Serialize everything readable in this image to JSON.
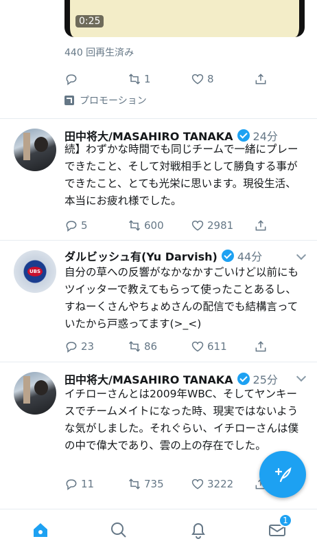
{
  "promo_tweet": {
    "video_duration": "0:25",
    "views": "440 回再生済み",
    "replies": "",
    "retweets": "1",
    "likes": "8",
    "promoted_label": "プロモーション"
  },
  "tweets": [
    {
      "author": "田中将大/MASAHIRO TANAKA",
      "time": "24分",
      "text": "続】わずかな時間でも同じチームで一緒にプレーできたこと、そして対戦相手として勝負する事ができたこと、とても光栄に思います。現役生活、本当にお疲れ様でした。",
      "replies": "5",
      "retweets": "600",
      "likes": "2981"
    },
    {
      "author": "ダルビッシュ有(Yu Darvish)",
      "time": "44分",
      "text": "自分の草への反響がなかなかすごいけど以前にもツイッターで教えてもらって使ったことあるし、すねーくさんやちょめさんの配信でも結構言っていたから戸惑ってます(>_<)",
      "replies": "23",
      "retweets": "86",
      "likes": "611"
    },
    {
      "author": "田中将大/MASAHIRO TANAKA",
      "time": "25分",
      "text": "イチローさんとは2009年WBC、そしてヤンキースでチームメイトになった時、現実ではないような気がしました。それぐらい、イチローさんは僕の中で偉大であり、雲の上の存在でした。",
      "replies": "11",
      "retweets": "735",
      "likes": "3222"
    }
  ],
  "nav": {
    "messages_badge": "1"
  },
  "colors": {
    "accent": "#1da1f2",
    "muted": "#657786"
  },
  "icons": [
    "reply-icon",
    "retweet-icon",
    "like-icon",
    "share-icon",
    "home-icon",
    "search-icon",
    "bell-icon",
    "mail-icon",
    "compose-icon"
  ]
}
